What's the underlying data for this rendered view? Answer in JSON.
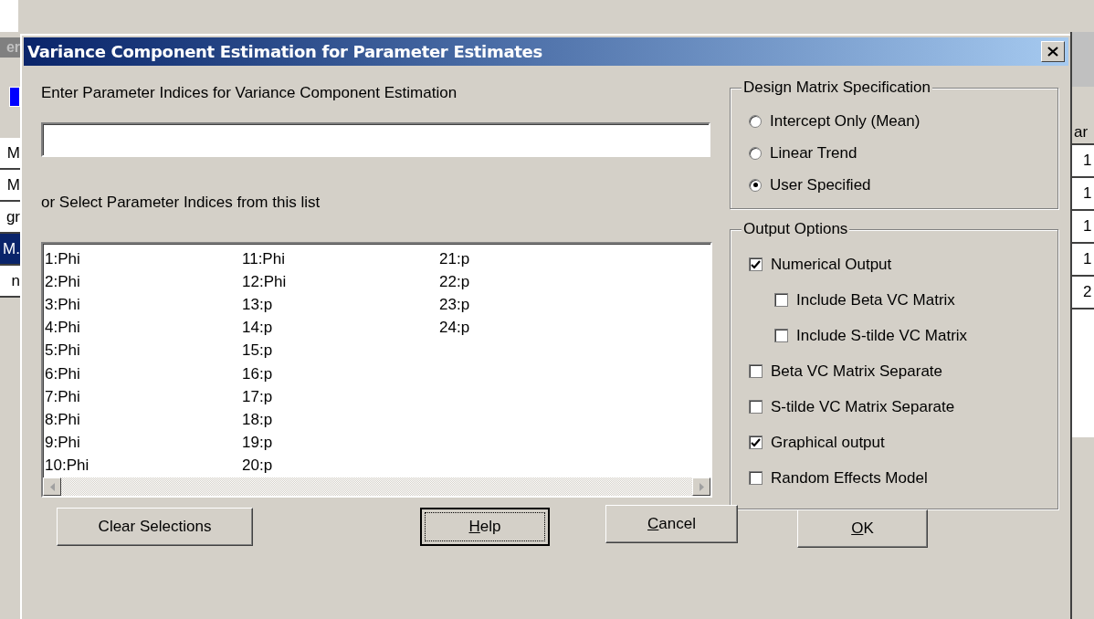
{
  "background_window": {
    "title_fragment": "er",
    "left_rows": [
      {
        "text": "M",
        "selected": false
      },
      {
        "text": "M",
        "selected": false
      },
      {
        "text": "gr",
        "selected": false
      },
      {
        "text": "M.",
        "selected": true
      },
      {
        "text": "n",
        "selected": false
      }
    ],
    "right_header": "ar",
    "right_cells": [
      "1",
      "1",
      "1",
      "1",
      "2"
    ]
  },
  "dialog": {
    "title": "Variance Component Estimation for Parameter Estimates",
    "indices_label": "Enter Parameter Indices for Variance Component Estimation",
    "list_label": "or Select Parameter Indices from this list",
    "parameters": [
      {
        "text": "1:Phi",
        "selected": false
      },
      {
        "text": "2:Phi",
        "selected": false
      },
      {
        "text": "3:Phi",
        "selected": false
      },
      {
        "text": "4:Phi",
        "selected": false
      },
      {
        "text": "5:Phi",
        "selected": false
      },
      {
        "text": "6:Phi",
        "selected": false
      },
      {
        "text": "7:Phi",
        "selected": false
      },
      {
        "text": "8:Phi",
        "selected": false
      },
      {
        "text": "9:Phi",
        "selected": false
      },
      {
        "text": "10:Phi",
        "selected": false
      },
      {
        "text": "11:Phi",
        "selected": false
      },
      {
        "text": "12:Phi",
        "selected": false
      },
      {
        "text": "13:p",
        "selected": false
      },
      {
        "text": "14:p",
        "selected": false
      },
      {
        "text": "15:p",
        "selected": false
      },
      {
        "text": "16:p",
        "selected": false
      },
      {
        "text": "17:p",
        "selected": false
      },
      {
        "text": "18:p",
        "selected": false
      },
      {
        "text": "19:p",
        "selected": false
      },
      {
        "text": "20:p",
        "selected": false
      },
      {
        "text": "21:p",
        "selected": false
      },
      {
        "text": "22:p",
        "selected": false
      },
      {
        "text": "23:p",
        "selected": false
      },
      {
        "text": "24:p",
        "selected": false
      }
    ],
    "design_matrix": {
      "title": "Design Matrix Specification",
      "options": [
        {
          "label": "Intercept Only (Mean)",
          "selected": false
        },
        {
          "label": "Linear Trend",
          "selected": false
        },
        {
          "label": "User Specified",
          "selected": true
        }
      ]
    },
    "output_options": {
      "title": "Output Options",
      "options": [
        {
          "label": "Numerical Output",
          "checked": true,
          "children": [
            {
              "label": "Include Beta VC Matrix",
              "checked": false
            },
            {
              "label": "Include S-tilde VC Matrix",
              "checked": false
            }
          ]
        },
        {
          "label": "Beta VC Matrix Separate",
          "checked": false
        },
        {
          "label": "S-tilde VC Matrix Separate",
          "checked": false
        },
        {
          "label": "Graphical output",
          "checked": true
        },
        {
          "label": "Random Effects Model",
          "checked": false
        }
      ]
    },
    "buttons": [
      {
        "label": "Clear Selections",
        "mnemonic": false,
        "focused": false
      },
      {
        "label": "Help",
        "mnemonic": true,
        "focused": true
      },
      {
        "label": "Cancel",
        "mnemonic": true,
        "focused": false
      },
      {
        "label": "OK",
        "mnemonic": true,
        "focused": false
      }
    ]
  }
}
